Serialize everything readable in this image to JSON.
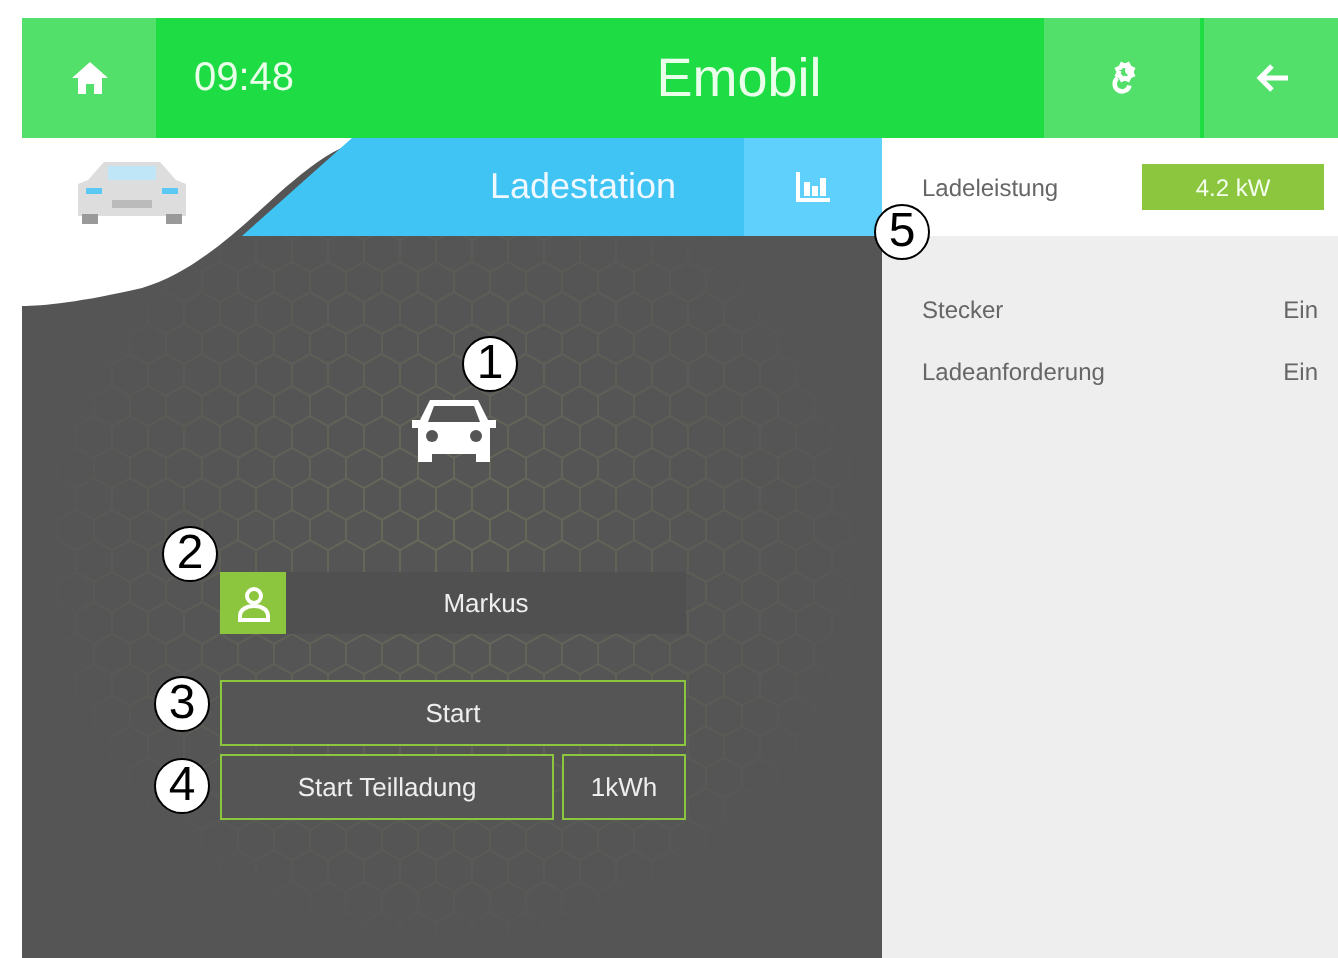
{
  "top_bar": {
    "time": "09:48",
    "title": "Emobil"
  },
  "station": {
    "title": "Ladestation",
    "user": "Markus",
    "buttons": [
      {
        "label": "Start",
        "kind": "full"
      },
      {
        "label": "Start Teilladung",
        "kind": "wide"
      },
      {
        "label": "1kWh",
        "kind": "narrow"
      }
    ]
  },
  "power": {
    "label": "Ladeleistung",
    "value": "4.2 kW"
  },
  "status": [
    {
      "label": "Stecker",
      "value": "Ein"
    },
    {
      "label": "Ladeanforderung",
      "value": "Ein"
    }
  ],
  "callouts": [
    {
      "label": "1"
    },
    {
      "label": "2"
    },
    {
      "label": "3"
    },
    {
      "label": "4"
    },
    {
      "label": "5"
    }
  ]
}
